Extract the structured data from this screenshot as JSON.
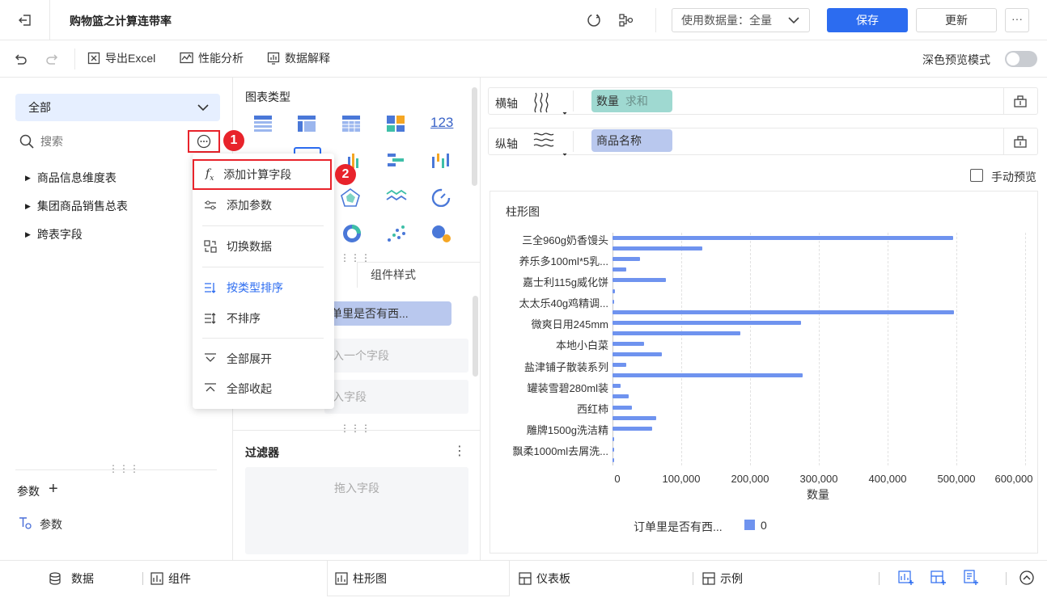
{
  "header": {
    "title": "购物篮之计算连带率",
    "data_volume_label": "使用数据量：全量",
    "save_label": "保存",
    "update_label": "更新",
    "more_label": "···"
  },
  "toolbar": {
    "export_label": "导出Excel",
    "perf_label": "性能分析",
    "explain_label": "数据解释",
    "dark_mode_label": "深色预览模式"
  },
  "left": {
    "dropdown_value": "全部",
    "search_placeholder": "搜索",
    "tree": [
      "商品信息维度表",
      "集团商品销售总表",
      "跨表字段"
    ],
    "params_title": "参数",
    "param_item": "参数"
  },
  "popup_menu": {
    "items": [
      "添加计算字段",
      "添加参数",
      "切换数据",
      "按类型排序",
      "不排序",
      "全部展开",
      "全部收起"
    ]
  },
  "badges": [
    "1",
    "2"
  ],
  "middle": {
    "chart_type_title": "图表类型",
    "style_tab": "组件样式",
    "field_chip": "单里是否有西...",
    "drop_field_1": "入一个字段",
    "drop_field_2": "入字段",
    "filter_title": "过滤器",
    "filter_drop": "拖入字段",
    "chart_type_number_icon": "123"
  },
  "right": {
    "x_axis_label": "横轴",
    "x_pill_field": "数量",
    "x_pill_agg": "求和",
    "y_axis_label": "纵轴",
    "y_pill_field": "商品名称",
    "manual_preview": "手动预览"
  },
  "chart_data": {
    "type": "bar",
    "orientation": "horizontal",
    "title": "柱形图",
    "xlabel": "数量",
    "ylabel": "",
    "xlim": [
      0,
      600000
    ],
    "x_ticks": [
      "0",
      "100,000",
      "200,000",
      "300,000",
      "400,000",
      "500,000",
      "600,000"
    ],
    "y_tick_labels": [
      "三全960g奶香馒头",
      "养乐多100ml*5乳...",
      "嘉士利115g威化饼",
      "太太乐40g鸡精调...",
      "微爽日用245mm",
      "本地小白菜",
      "盐津铺子散装系列",
      "罐装雪碧280ml装",
      "西红柿",
      "雕牌1500g洗洁精",
      "飘柔1000ml去屑洗..."
    ],
    "values": [
      495000,
      130000,
      40000,
      20000,
      78000,
      3000,
      2000,
      497000,
      274000,
      186000,
      46000,
      72000,
      20000,
      277000,
      12000,
      23000,
      28000,
      64000,
      58000,
      1500,
      1200,
      800
    ],
    "legend_title": "订单里是否有西...",
    "series": [
      {
        "name": "0",
        "color": "#6f93ef"
      }
    ],
    "grid": true
  },
  "bottom": {
    "data_tab": "数据",
    "component_tab": "组件",
    "bar_tab": "柱形图",
    "dashboard_tab": "仪表板",
    "example_tab": "示例"
  }
}
